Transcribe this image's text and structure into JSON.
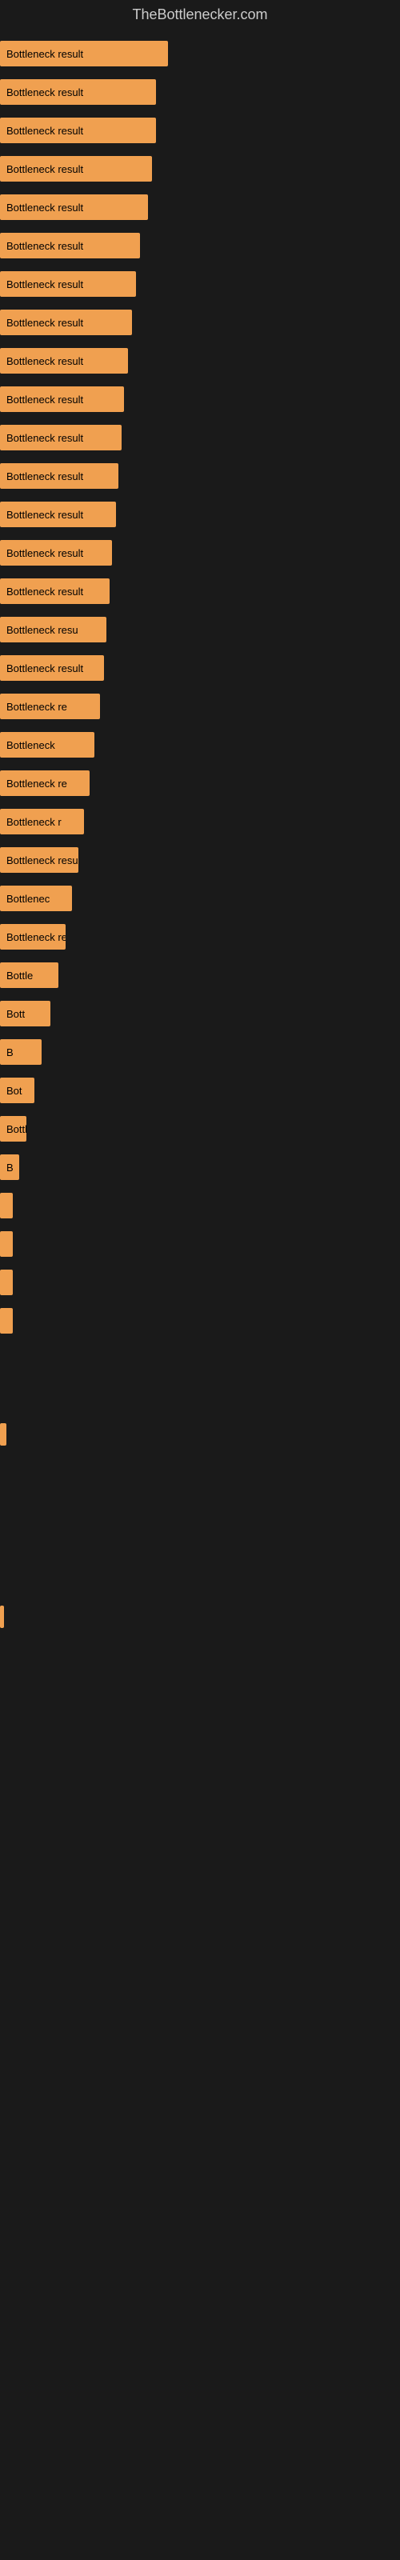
{
  "site": {
    "title": "TheBottlenecker.com"
  },
  "bars": [
    {
      "label": "Bottleneck result"
    },
    {
      "label": "Bottleneck result"
    },
    {
      "label": "Bottleneck result"
    },
    {
      "label": "Bottleneck result"
    },
    {
      "label": "Bottleneck result"
    },
    {
      "label": "Bottleneck result"
    },
    {
      "label": "Bottleneck result"
    },
    {
      "label": "Bottleneck result"
    },
    {
      "label": "Bottleneck result"
    },
    {
      "label": "Bottleneck result"
    },
    {
      "label": "Bottleneck result"
    },
    {
      "label": "Bottleneck result"
    },
    {
      "label": "Bottleneck result"
    },
    {
      "label": "Bottleneck result"
    },
    {
      "label": "Bottleneck result"
    },
    {
      "label": "Bottleneck resu"
    },
    {
      "label": "Bottleneck result"
    },
    {
      "label": "Bottleneck re"
    },
    {
      "label": "Bottleneck"
    },
    {
      "label": "Bottleneck re"
    },
    {
      "label": "Bottleneck r"
    },
    {
      "label": "Bottleneck resu"
    },
    {
      "label": "Bottlenec"
    },
    {
      "label": "Bottleneck re"
    },
    {
      "label": "Bottle"
    },
    {
      "label": "Bott"
    },
    {
      "label": "B"
    },
    {
      "label": "Bot"
    },
    {
      "label": "Bottlen"
    },
    {
      "label": "B"
    },
    {
      "label": ""
    },
    {
      "label": ""
    },
    {
      "label": ""
    },
    {
      "label": ""
    }
  ],
  "bottom_bars": [
    {
      "label": ""
    },
    {
      "label": ""
    }
  ]
}
